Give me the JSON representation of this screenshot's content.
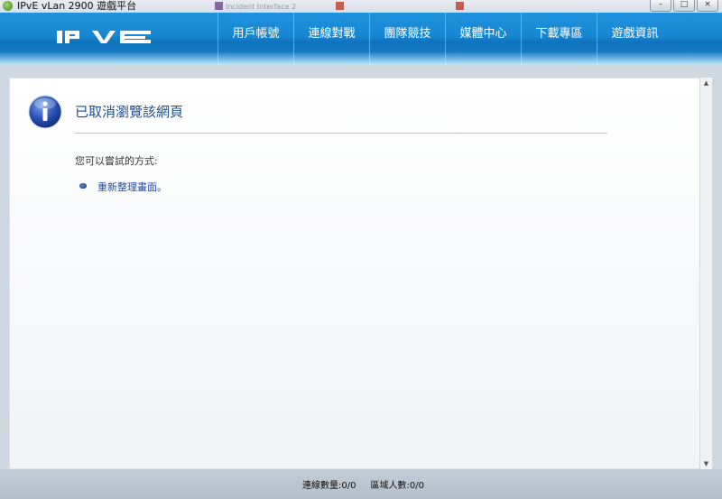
{
  "window": {
    "title": "IPvE vLan 2900 遊戲平台",
    "background_tabs": [
      "Incident Interface 2",
      "",
      "",
      "",
      ""
    ]
  },
  "header": {
    "logo_text": "IPVE",
    "nav": [
      {
        "label": "用戶帳號"
      },
      {
        "label": "連線對戰"
      },
      {
        "label": "團隊競技"
      },
      {
        "label": "媒體中心"
      },
      {
        "label": "下載專區"
      },
      {
        "label": "遊戲資訊"
      }
    ]
  },
  "content": {
    "heading": "已取消瀏覽該網頁",
    "suggestion": "您可以嘗試的方式:",
    "refresh_link": "重新整理畫面。"
  },
  "status": {
    "connections": "連線數量:0/0",
    "area_people": "區域人數:0/0"
  },
  "icons": {
    "app": "ipve-app-icon",
    "info": "info-icon",
    "bullet": "bullet-icon"
  },
  "colors": {
    "header": "#1887d2",
    "heading_text": "#1c4f8f",
    "link": "#1e4ea3",
    "statusbar": "#b7c2cd"
  }
}
